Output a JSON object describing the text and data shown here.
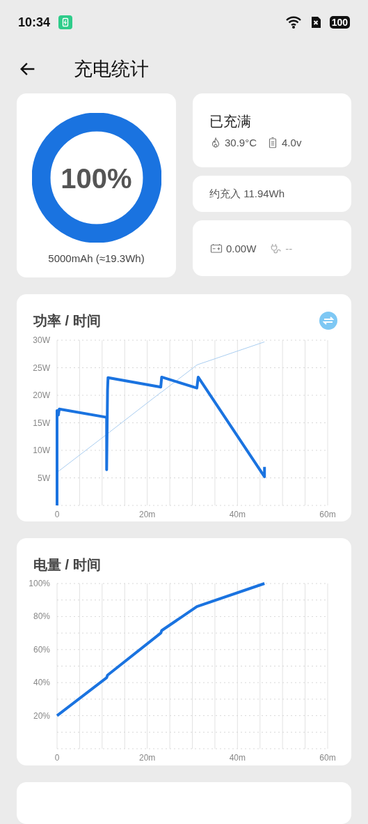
{
  "status_bar": {
    "time": "10:34",
    "battery": "100"
  },
  "header": {
    "title": "充电统计"
  },
  "battery_card": {
    "percent": "100%",
    "level": 1,
    "capacity": "5000mAh (≈19.3Wh)"
  },
  "status_card": {
    "state": "已充满",
    "temperature": "30.9°C",
    "voltage": "4.0v"
  },
  "energy_card": {
    "text": "约充入 11.94Wh"
  },
  "power_card": {
    "battery_power": "0.00W",
    "charger_power": "--"
  },
  "power_chart": {
    "title": "功率 / 时间",
    "chart_data": {
      "type": "line",
      "x": [
        0,
        0,
        0.3,
        0.5,
        11,
        11,
        11.2,
        11.3,
        23,
        23.2,
        31,
        31.3,
        46,
        46
      ],
      "grid": true,
      "series": [
        {
          "color": "#1a73e0",
          "values": [
            0,
            17.2,
            16.4,
            17.5,
            16,
            6.5,
            21,
            23.2,
            21.5,
            23.3,
            21.3,
            23.3,
            5.2,
            7
          ]
        },
        {
          "color": "#a9cdf0",
          "values": [
            6,
            6,
            6.2,
            6.3,
            12.9,
            12.9,
            13,
            13.1,
            20.5,
            20.6,
            25.5,
            25.6,
            29.7,
            29.7
          ]
        }
      ],
      "xlim": [
        0,
        60
      ],
      "ylim": [
        0,
        30
      ],
      "xticks": [
        {
          "value": 0,
          "label": "0"
        },
        {
          "value": 20,
          "label": "20m"
        },
        {
          "value": 40,
          "label": "40m"
        },
        {
          "value": 60,
          "label": "60m"
        }
      ],
      "yticks": [
        {
          "value": 5,
          "label": "5W"
        },
        {
          "value": 10,
          "label": "10W"
        },
        {
          "value": 15,
          "label": "15W"
        },
        {
          "value": 20,
          "label": "20W"
        },
        {
          "value": 25,
          "label": "25W"
        },
        {
          "value": 30,
          "label": "30W"
        }
      ]
    }
  },
  "level_chart": {
    "title": "电量 / 时间",
    "chart_data": {
      "type": "line",
      "x": [
        0,
        11,
        11.2,
        23,
        23.2,
        31,
        46
      ],
      "grid": true,
      "series": [
        {
          "color": "#1a73e0",
          "values": [
            20,
            43,
            44.5,
            70,
            71.5,
            86,
            100
          ]
        }
      ],
      "xlim": [
        0,
        60
      ],
      "ylim": [
        0,
        100
      ],
      "xticks": [
        {
          "value": 0,
          "label": "0"
        },
        {
          "value": 20,
          "label": "20m"
        },
        {
          "value": 40,
          "label": "40m"
        },
        {
          "value": 60,
          "label": "60m"
        }
      ],
      "yticks": [
        {
          "value": 20,
          "label": "20%"
        },
        {
          "value": 40,
          "label": "40%"
        },
        {
          "value": 60,
          "label": "60%"
        },
        {
          "value": 80,
          "label": "80%"
        },
        {
          "value": 100,
          "label": "100%"
        }
      ]
    }
  }
}
